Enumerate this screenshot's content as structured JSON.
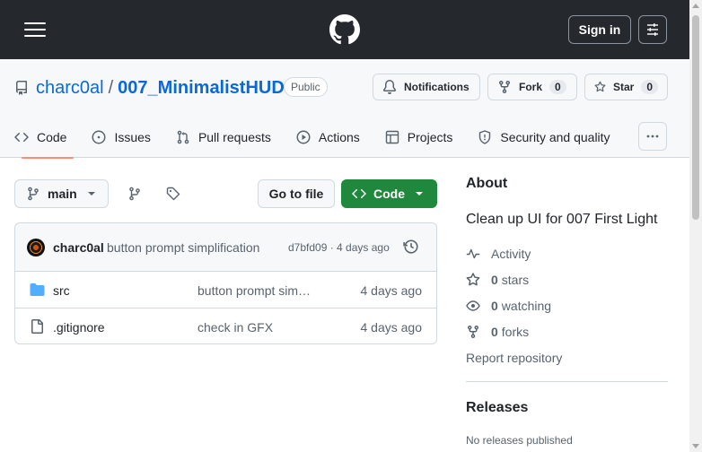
{
  "topbar": {
    "signin_label": "Sign in"
  },
  "repo": {
    "owner": "charc0al",
    "separator": "/",
    "name": "007_MinimalistHUD",
    "visibility": "Public",
    "notifications_label": "Notifications",
    "fork_label": "Fork",
    "fork_count": "0",
    "star_label": "Star",
    "star_count": "0"
  },
  "tabs": [
    {
      "label": "Code",
      "icon": "code-icon",
      "active": true
    },
    {
      "label": "Issues",
      "icon": "issue-icon"
    },
    {
      "label": "Pull requests",
      "icon": "pull-request-icon"
    },
    {
      "label": "Actions",
      "icon": "play-icon"
    },
    {
      "label": "Projects",
      "icon": "table-icon"
    },
    {
      "label": "Security and quality",
      "icon": "shield-icon"
    }
  ],
  "toolbar": {
    "branch": "main",
    "go_to_file": "Go to file",
    "code_label": "Code"
  },
  "commit": {
    "author": "charc0al",
    "message": "button prompt simplification",
    "meta": "d7bfd09 · 4 days ago"
  },
  "files": [
    {
      "name": "src",
      "type": "folder",
      "message": "button prompt sim…",
      "date": "4 days ago"
    },
    {
      "name": ".gitignore",
      "type": "file",
      "message": "check in GFX",
      "date": "4 days ago"
    }
  ],
  "about": {
    "heading": "About",
    "description": "Clean up UI for 007 First Light",
    "activity": "Activity",
    "stars_count": "0",
    "stars_label": "stars",
    "watching_count": "0",
    "watching_label": "watching",
    "forks_count": "0",
    "forks_label": "forks",
    "report": "Report repository"
  },
  "releases": {
    "heading": "Releases",
    "empty": "No releases published"
  },
  "colors": {
    "header_bg": "#25292e",
    "link": "#0969da",
    "primary_button": "#1f883d",
    "active_tab_underline": "#fd8c73"
  }
}
